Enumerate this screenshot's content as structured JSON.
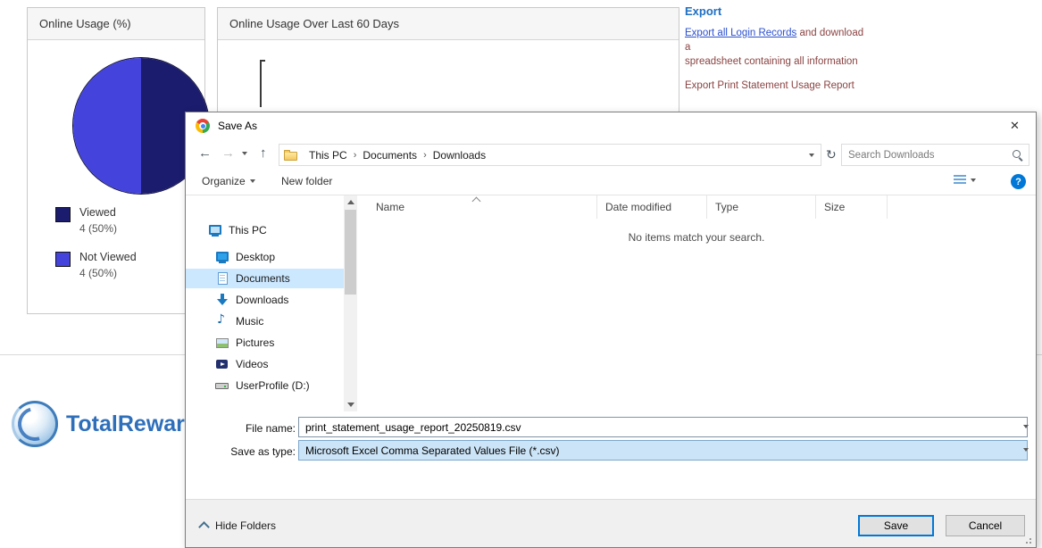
{
  "page": {
    "pie_panel": {
      "title": "Online Usage (%)"
    },
    "chart_panel": {
      "title": "Online Usage Over Last 60 Days"
    },
    "export": {
      "heading": "Export",
      "login_link": "Export all Login Records",
      "login_suffix": " and download a",
      "login_line2": "spreadsheet containing all information",
      "print_link": "Export Print Statement Usage Report"
    },
    "logo_text": "TotalRewards S"
  },
  "chart_data": {
    "type": "pie",
    "title": "Online Usage (%)",
    "labels": [
      "Viewed",
      "Not Viewed"
    ],
    "values": [
      4,
      4
    ],
    "value_labels": [
      "4 (50%)",
      "4 (50%)"
    ],
    "percents": [
      50,
      50
    ],
    "colors": [
      "#1c1c6e",
      "#4444dc"
    ],
    "legend_position": "bottom-left"
  },
  "dialog": {
    "title": "Save As",
    "close_label": "✕",
    "nav": {
      "back_glyph": "←",
      "forward_glyph": "→",
      "up_glyph": "↑",
      "refresh_glyph": "↻",
      "breadcrumb": [
        "This PC",
        "Documents",
        "Downloads"
      ],
      "search_placeholder": "Search Downloads"
    },
    "toolbar": {
      "organize_label": "Organize",
      "new_folder_label": "New folder",
      "help_label": "?"
    },
    "sidebar_items": [
      {
        "label": "This PC",
        "icon": "this-pc",
        "selected": false
      },
      {
        "label": "Desktop",
        "icon": "desktop",
        "selected": false
      },
      {
        "label": "Documents",
        "icon": "documents",
        "selected": true
      },
      {
        "label": "Downloads",
        "icon": "downloads",
        "selected": false
      },
      {
        "label": "Music",
        "icon": "music",
        "selected": false
      },
      {
        "label": "Pictures",
        "icon": "pictures",
        "selected": false
      },
      {
        "label": "Videos",
        "icon": "videos",
        "selected": false
      },
      {
        "label": "UserProfile (D:)",
        "icon": "drive",
        "selected": false
      }
    ],
    "list": {
      "columns": [
        "Name",
        "Date modified",
        "Type",
        "Size"
      ],
      "empty_message": "No items match your search."
    },
    "file_name": {
      "label": "File name:",
      "value": "print_statement_usage_report_20250819.csv"
    },
    "save_as_type": {
      "label": "Save as type:",
      "value": "Microsoft Excel Comma Separated Values File (*.csv)"
    },
    "footer": {
      "hide_folders_label": "Hide Folders",
      "save_label": "Save",
      "cancel_label": "Cancel"
    }
  },
  "colors": {
    "accent": "#0078d7",
    "sidebar_selection": "#cce8ff",
    "save_type_highlight": "#cce4f7",
    "export_heading": "#1f6fc4",
    "export_link": "#2b4fd0",
    "export_text": "#8b4343",
    "pie_viewed": "#1c1c6e",
    "pie_not_viewed": "#4444dc",
    "logo_blue": "#2f6fba"
  }
}
